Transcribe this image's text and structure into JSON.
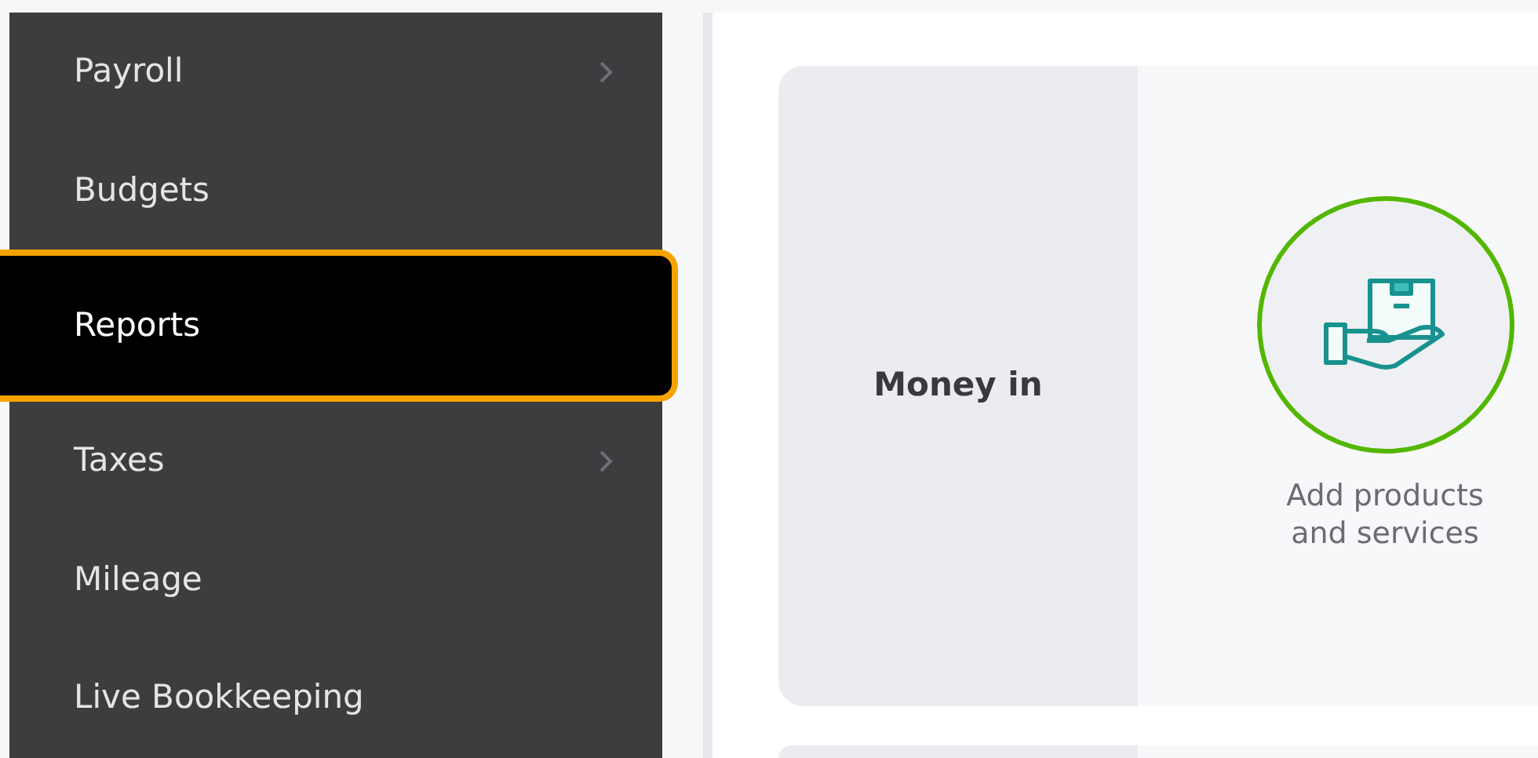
{
  "sidebar": {
    "items": [
      {
        "label": "Payroll",
        "selected": false,
        "has_submenu": true
      },
      {
        "label": "Budgets",
        "selected": false,
        "has_submenu": false
      },
      {
        "label": "Reports",
        "selected": true,
        "has_submenu": false
      },
      {
        "label": "Taxes",
        "selected": false,
        "has_submenu": true
      },
      {
        "label": "Mileage",
        "selected": false,
        "has_submenu": false
      },
      {
        "label": "Live Bookkeeping",
        "selected": false,
        "has_submenu": false
      }
    ]
  },
  "sections": [
    {
      "title": "Money in",
      "actions": [
        {
          "lines": [
            "Add products",
            "and services"
          ]
        }
      ]
    }
  ]
}
